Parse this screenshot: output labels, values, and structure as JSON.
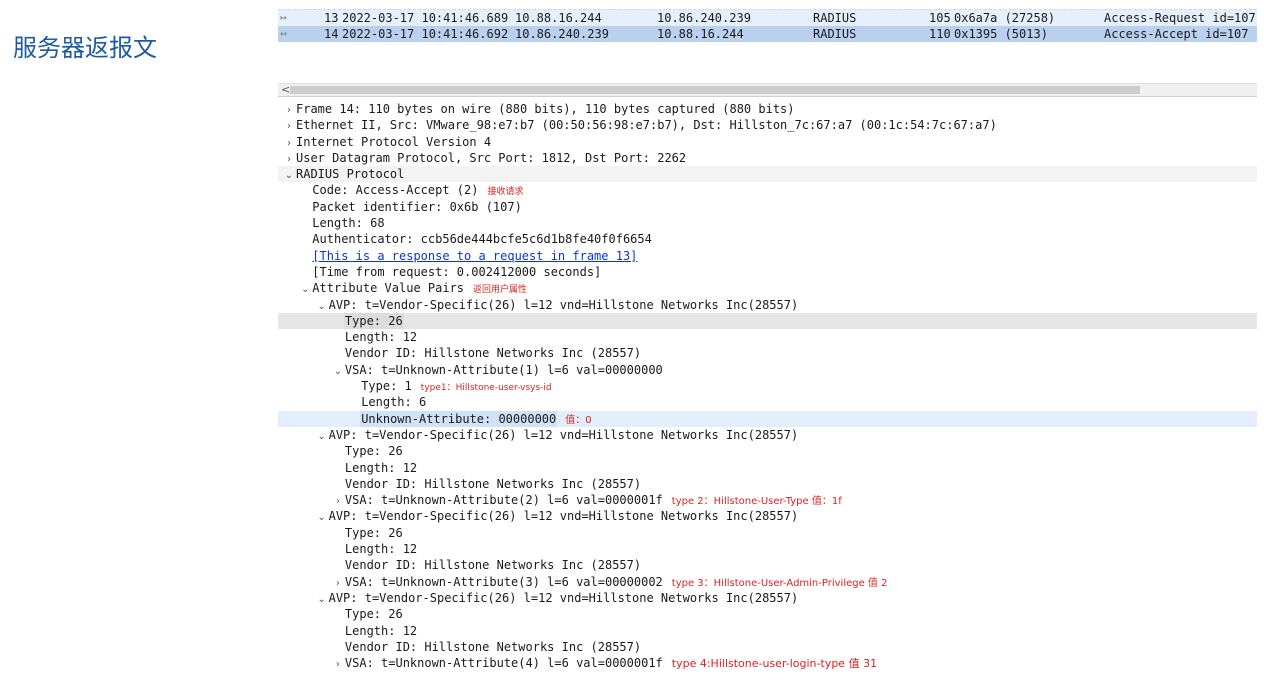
{
  "slide": {
    "title": "服务器返报文"
  },
  "packets": [
    {
      "no": "13",
      "time": "2022-03-17 10:41:46.689",
      "src": "10.88.16.244",
      "dst": "10.86.240.239",
      "proto": "RADIUS",
      "len": "105",
      "ident": "0x6a7a (27258)",
      "info": "Access-Request id=107",
      "rel_icon": "↦"
    },
    {
      "no": "14",
      "time": "2022-03-17 10:41:46.692",
      "src": "10.86.240.239",
      "dst": "10.88.16.244",
      "proto": "RADIUS",
      "len": "110",
      "ident": "0x1395 (5013)",
      "info": "Access-Accept id=107",
      "rel_icon": "↤"
    }
  ],
  "scrollbar": {
    "left_arrow": "<"
  },
  "tree": [
    {
      "level": 0,
      "toggle": "›",
      "text": "Frame 14: 110 bytes on wire (880 bits), 110 bytes captured (880 bits)"
    },
    {
      "level": 0,
      "toggle": "›",
      "text": "Ethernet II, Src: VMware_98:e7:b7 (00:50:56:98:e7:b7), Dst: Hillston_7c:67:a7 (00:1c:54:7c:67:a7)"
    },
    {
      "level": 0,
      "toggle": "›",
      "text": "Internet Protocol Version 4"
    },
    {
      "level": 0,
      "toggle": "›",
      "text": "User Datagram Protocol, Src Port: 1812, Dst Port: 2262"
    },
    {
      "level": 0,
      "toggle": "⌄",
      "text": "RADIUS Protocol",
      "hl": "radius-head"
    },
    {
      "level": 1,
      "toggle": "",
      "text": "Code: Access-Accept (2)",
      "note": "接收请求",
      "note_small": true
    },
    {
      "level": 1,
      "toggle": "",
      "text": "Packet identifier: 0x6b (107)"
    },
    {
      "level": 1,
      "toggle": "",
      "text": "Length: 68"
    },
    {
      "level": 1,
      "toggle": "",
      "text": "Authenticator: ccb56de444bcfe5c6d1b8fe40f0f6654"
    },
    {
      "level": 1,
      "toggle": "",
      "text": "[This is a response to a request in frame 13]",
      "link": true
    },
    {
      "level": 1,
      "toggle": "",
      "text": "[Time from request: 0.002412000 seconds]"
    },
    {
      "level": 1,
      "toggle": "⌄",
      "text": "Attribute Value Pairs",
      "note": "返回用户属性",
      "note_small": true
    },
    {
      "level": 2,
      "toggle": "⌄",
      "text": "AVP: t=Vendor-Specific(26) l=12 vnd=Hillstone Networks Inc(28557)"
    },
    {
      "level": 3,
      "toggle": "",
      "text": "Type: 26",
      "hl": "hl-gray"
    },
    {
      "level": 3,
      "toggle": "",
      "text": "Length: 12"
    },
    {
      "level": 3,
      "toggle": "",
      "text": "Vendor ID: Hillstone Networks Inc (28557)"
    },
    {
      "level": 3,
      "toggle": "⌄",
      "text": "VSA: t=Unknown-Attribute(1) l=6 val=00000000"
    },
    {
      "level": 4,
      "toggle": "",
      "text": "Type: 1",
      "note": "type1：Hillstone-user-vsys-id",
      "note_small": true
    },
    {
      "level": 4,
      "toggle": "",
      "text": "Length: 6"
    },
    {
      "level": 4,
      "toggle": "",
      "text": "Unknown-Attribute: 00000000",
      "hl": "hl-sel",
      "note": "值：0"
    },
    {
      "level": 2,
      "toggle": "⌄",
      "text": "AVP: t=Vendor-Specific(26) l=12 vnd=Hillstone Networks Inc(28557)"
    },
    {
      "level": 3,
      "toggle": "",
      "text": "Type: 26"
    },
    {
      "level": 3,
      "toggle": "",
      "text": "Length: 12"
    },
    {
      "level": 3,
      "toggle": "",
      "text": "Vendor ID: Hillstone Networks Inc (28557)"
    },
    {
      "level": 3,
      "toggle": "›",
      "text": "VSA: t=Unknown-Attribute(2) l=6 val=0000001f",
      "note": "type 2：Hillstone-User-Type  值：1f"
    },
    {
      "level": 2,
      "toggle": "⌄",
      "text": "AVP: t=Vendor-Specific(26) l=12 vnd=Hillstone Networks Inc(28557)"
    },
    {
      "level": 3,
      "toggle": "",
      "text": "Type: 26"
    },
    {
      "level": 3,
      "toggle": "",
      "text": "Length: 12"
    },
    {
      "level": 3,
      "toggle": "",
      "text": "Vendor ID: Hillstone Networks Inc (28557)"
    },
    {
      "level": 3,
      "toggle": "›",
      "text": "VSA: t=Unknown-Attribute(3) l=6 val=00000002",
      "note": "type 3：Hillstone-User-Admin-Privilege  值 2"
    },
    {
      "level": 2,
      "toggle": "⌄",
      "text": "AVP: t=Vendor-Specific(26) l=12 vnd=Hillstone Networks Inc(28557)"
    },
    {
      "level": 3,
      "toggle": "",
      "text": "Type: 26"
    },
    {
      "level": 3,
      "toggle": "",
      "text": "Length: 12"
    },
    {
      "level": 3,
      "toggle": "",
      "text": "Vendor ID: Hillstone Networks Inc (28557)"
    },
    {
      "level": 3,
      "toggle": "›",
      "text": "VSA: t=Unknown-Attribute(4) l=6 val=0000001f",
      "note": "type 4:Hillstone-user-login-type 值 31",
      "note_big": true
    }
  ]
}
